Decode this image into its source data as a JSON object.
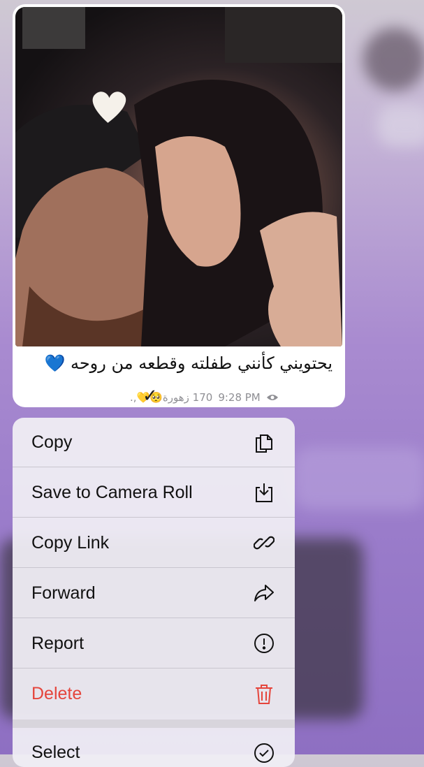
{
  "message": {
    "caption": "يحتويني كأنني طفلته وقطعه من روحه 💙",
    "time": "9:28 PM",
    "signature": "170 زهورة🥺💛,.",
    "check": "✓"
  },
  "menu": {
    "items": [
      {
        "label": "Copy",
        "icon": "copy-icon"
      },
      {
        "label": "Save to Camera Roll",
        "icon": "download-icon"
      },
      {
        "label": "Copy Link",
        "icon": "link-icon"
      },
      {
        "label": "Forward",
        "icon": "forward-icon"
      },
      {
        "label": "Report",
        "icon": "report-icon"
      },
      {
        "label": "Delete",
        "icon": "trash-icon",
        "color": "#e5453c"
      },
      {
        "label": "Select",
        "icon": "select-check-icon"
      }
    ]
  }
}
